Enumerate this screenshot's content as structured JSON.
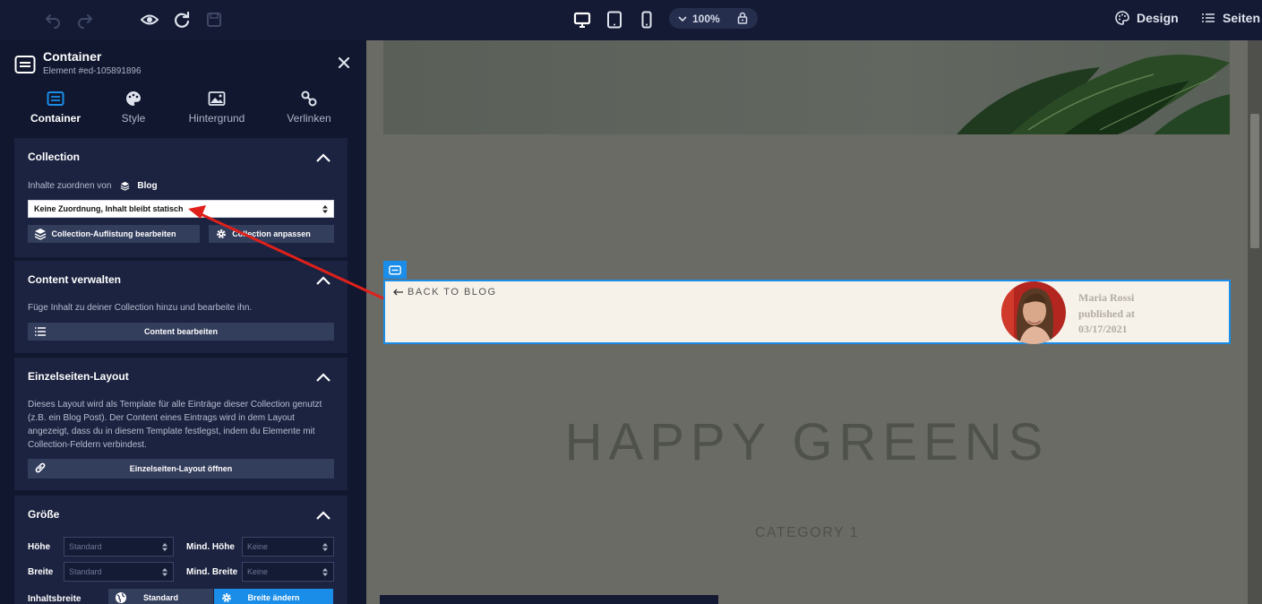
{
  "topbar": {
    "left_icons": [
      "undo-icon",
      "redo-icon",
      "preview-eye-icon",
      "refresh-icon",
      "save-icon"
    ],
    "device_icons": [
      "desktop-icon",
      "tablet-icon",
      "mobile-icon"
    ],
    "zoom": "100%",
    "design_label": "Design",
    "pages_label": "Seiten"
  },
  "panel": {
    "title": "Container",
    "subtitle": "Element #ed-105891896",
    "tabs": [
      {
        "label": "Container",
        "icon": "container-icon",
        "active": true
      },
      {
        "label": "Style",
        "icon": "palette-icon",
        "active": false
      },
      {
        "label": "Hintergrund",
        "icon": "image-icon",
        "active": false
      },
      {
        "label": "Verlinken",
        "icon": "link-icon",
        "active": false
      }
    ],
    "collection": {
      "title": "Collection",
      "assign_label": "Inhalte zuordnen von",
      "assign_value": "Blog",
      "select_value": "Keine Zuordnung, Inhalt bleibt statisch",
      "btn_edit_listing": "Collection-Auflistung bearbeiten",
      "btn_customize": "Collection anpassen"
    },
    "content": {
      "title": "Content verwalten",
      "description": "Füge Inhalt zu deiner Collection hinzu und bearbeite ihn.",
      "btn_edit": "Content bearbeiten"
    },
    "single_layout": {
      "title": "Einzelseiten-Layout",
      "description_lines": [
        "Dieses Layout wird als Template für alle Einträge dieser Collection genutzt",
        "(z.B. ein Blog Post). Der Content eines Eintrags wird in dem Layout",
        "angezeigt, dass du in diesem Template festlegst, indem du Elemente mit",
        "Collection-Feldern verbindest."
      ],
      "btn_open": "Einzelseiten-Layout öffnen"
    },
    "size": {
      "title": "Größe",
      "height_label": "Höhe",
      "height_value": "Standard",
      "min_height_label": "Mind. Höhe",
      "min_height_value": "Keine",
      "width_label": "Breite",
      "width_value": "Standard",
      "min_width_label": "Mind. Breite",
      "min_width_value": "Keine",
      "content_width_label": "Inhaltsbreite",
      "btn_standard": "Standard",
      "btn_change_width": "Breite ändern"
    }
  },
  "canvas": {
    "back_link": "BACK TO BLOG",
    "author_name": "Maria Rossi",
    "published_label": "published at",
    "published_date": "03/17/2021",
    "title": "HAPPY GREENS",
    "category": "CATEGORY 1"
  },
  "colors": {
    "panel_bg": "#10172e",
    "section_bg": "#1c2340",
    "accent_blue": "#1a8de8",
    "annotation_arrow": "#e0201b"
  }
}
